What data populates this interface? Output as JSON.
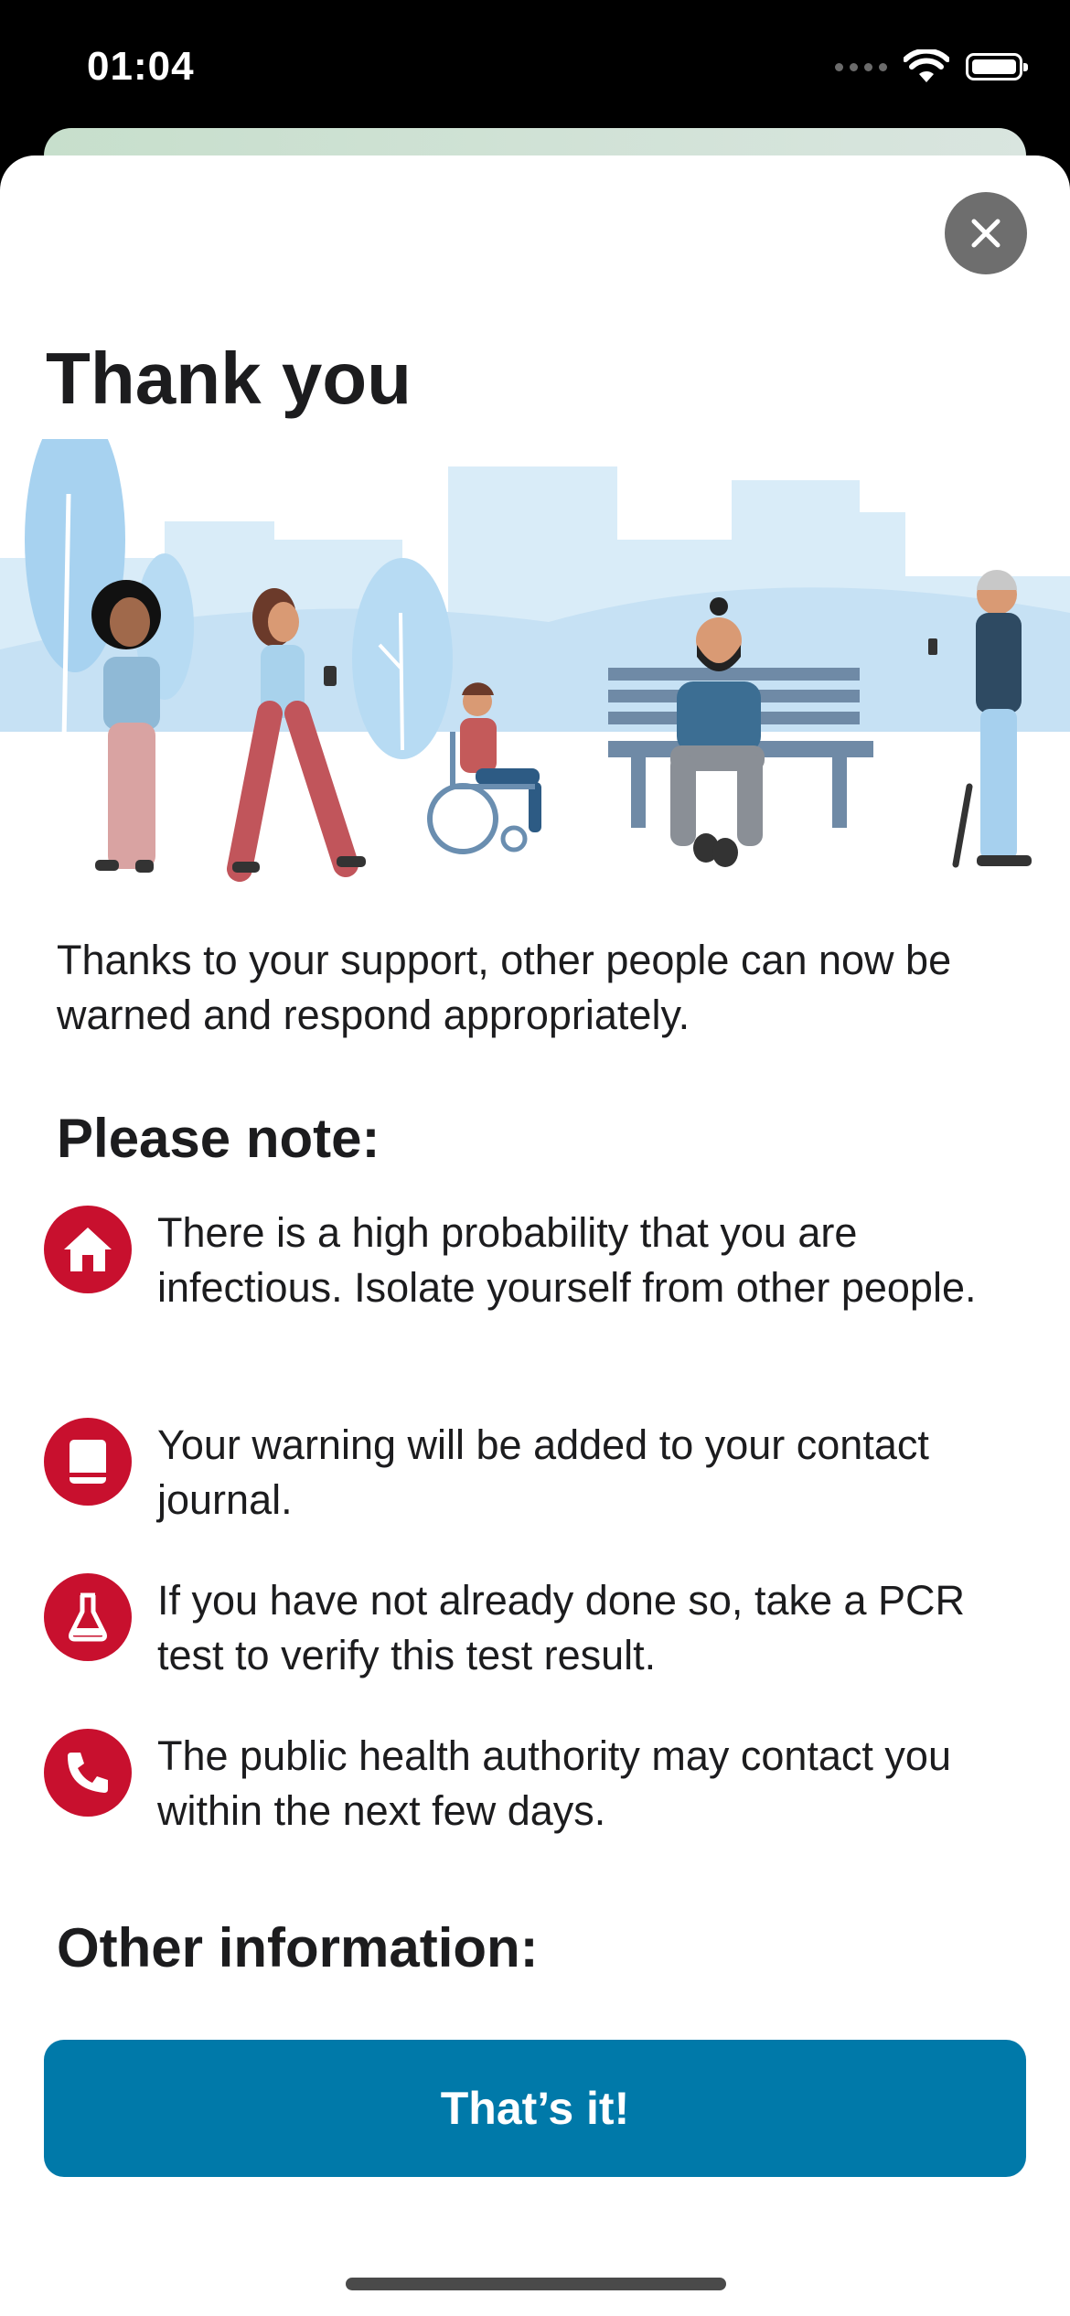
{
  "status_bar": {
    "time": "01:04"
  },
  "sheet": {
    "title": "Thank you",
    "intro": "Thanks to your support, other people can now be warned and respond appropriately.",
    "please_note_heading": "Please note:",
    "notes": [
      {
        "icon": "home-icon",
        "text": "There is a high probability that you are infectious. Isolate yourself from other people."
      },
      {
        "icon": "journal-icon",
        "text": "Your warning will be added to your contact journal."
      },
      {
        "icon": "test-flask-icon",
        "text": "If you have not already done so, take a PCR test to verify this test result."
      },
      {
        "icon": "phone-icon",
        "text": "The public health authority may contact you within the next few days."
      }
    ],
    "other_info_heading": "Other information:",
    "primary_button_label": "That’s it!"
  },
  "colors": {
    "accent_red": "#c8102e",
    "primary_blue": "#0079a9",
    "illustration_sky": "#d9ecf8"
  }
}
